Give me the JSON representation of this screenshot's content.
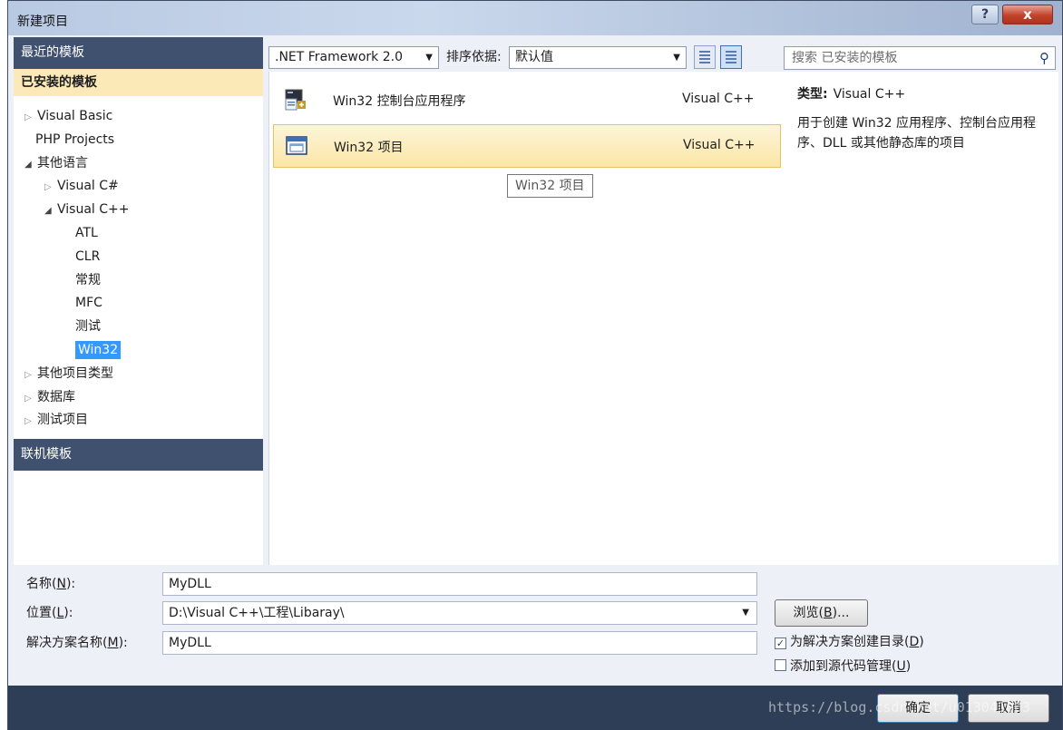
{
  "window": {
    "title": "新建项目",
    "help_glyph": "?",
    "close_glyph": "x"
  },
  "left_panel": {
    "recent_header": "最近的模板",
    "installed_header": "已安装的模板",
    "online_header": "联机模板",
    "tree": [
      {
        "label": "Visual Basic",
        "state": "collapsed"
      },
      {
        "label": "PHP Projects",
        "state": "leaf"
      },
      {
        "label": "其他语言",
        "state": "expanded"
      },
      {
        "label": "Visual C#",
        "state": "collapsed"
      },
      {
        "label": "Visual C++",
        "state": "expanded"
      },
      {
        "label": "ATL",
        "state": "leaf"
      },
      {
        "label": "CLR",
        "state": "leaf"
      },
      {
        "label": "常规",
        "state": "leaf"
      },
      {
        "label": "MFC",
        "state": "leaf"
      },
      {
        "label": "测试",
        "state": "leaf"
      },
      {
        "label": "Win32",
        "state": "selected"
      },
      {
        "label": "其他项目类型",
        "state": "collapsed"
      },
      {
        "label": "数据库",
        "state": "collapsed"
      },
      {
        "label": "测试项目",
        "state": "collapsed"
      }
    ],
    "arrow_collapsed": "▷",
    "arrow_expanded": "◢"
  },
  "toolbar": {
    "framework": ".NET Framework 2.0",
    "sort_label": "排序依据:",
    "sort_value": "默认值",
    "dropdown_glyph": "▼"
  },
  "templates": [
    {
      "name": "Win32 控制台应用程序",
      "language": "Visual C++",
      "icon": "console-app-icon"
    },
    {
      "name": "Win32 项目",
      "language": "Visual C++",
      "icon": "win32-project-icon",
      "selected": true
    }
  ],
  "tooltip": "Win32 项目",
  "search": {
    "placeholder": "搜索 已安装的模板",
    "icon_glyph": "⚲"
  },
  "details": {
    "type_label": "类型:",
    "type_value": "Visual C++",
    "description": "用于创建 Win32 应用程序、控制台应用程序、DLL 或其他静态库的项目"
  },
  "form": {
    "name_label": "名称",
    "name_key": "N",
    "name_value": "MyDLL",
    "location_label": "位置",
    "location_key": "L",
    "location_value": "D:\\Visual C++\\工程\\Libaray\\",
    "solution_label": "解决方案名称",
    "solution_key": "M",
    "solution_value": "MyDLL",
    "browse_label": "浏览",
    "browse_key": "B",
    "create_dir_label": "为解决方案创建目录",
    "create_dir_key": "D",
    "create_dir_checked": true,
    "source_control_label": "添加到源代码管理",
    "source_control_key": "U",
    "source_control_checked": false,
    "check_glyph": "✓"
  },
  "footer": {
    "ok_label": "确定",
    "cancel_label": "取消",
    "watermark": "https://blog.csdn.net/u013041063"
  }
}
